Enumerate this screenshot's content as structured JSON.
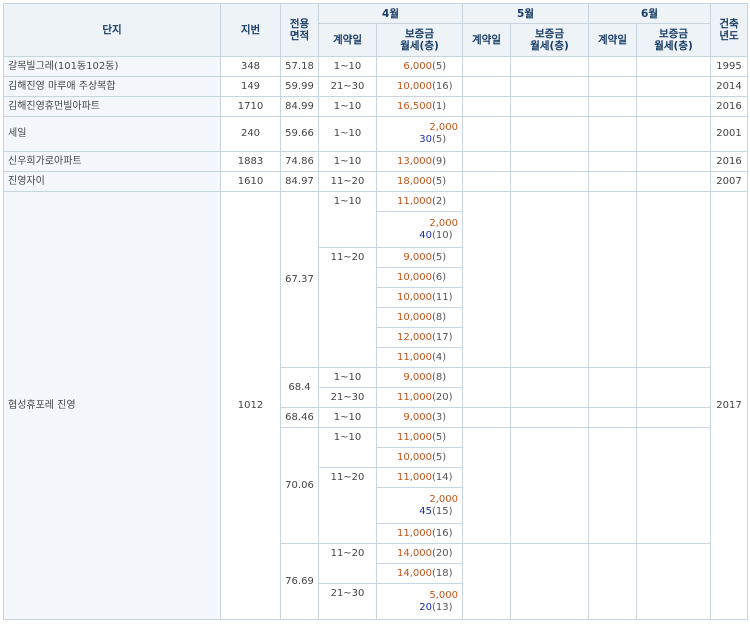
{
  "header": {
    "complex": "단지",
    "lot": "지번",
    "area": "전용\n면적",
    "months": [
      "4월",
      "5월",
      "6월"
    ],
    "contract_day": "계약일",
    "price": "보증금\n월세(층)",
    "built": "건축\n년도"
  },
  "rows": [
    {
      "name": "갈목빌그레(101동102동)",
      "lot": "348",
      "area": "57.18",
      "day": "1~10",
      "dep": "6,000",
      "floor": "(5)",
      "built": "1995"
    },
    {
      "name": "김해진영 마루애 주상복합",
      "lot": "149",
      "area": "59.99",
      "day": "21~30",
      "dep": "10,000",
      "floor": "(16)",
      "built": "2014"
    },
    {
      "name": "김해진영휴먼빌아파트",
      "lot": "1710",
      "area": "84.99",
      "day": "1~10",
      "dep": "16,500",
      "floor": "(1)",
      "built": "2016"
    },
    {
      "name": "세일",
      "lot": "240",
      "area": "59.66",
      "day": "1~10",
      "dep": "2,000",
      "rent": "30",
      "floor": "(5)",
      "built": "2001"
    },
    {
      "name": "신우희가로아파트",
      "lot": "1883",
      "area": "74.86",
      "day": "1~10",
      "dep": "13,000",
      "floor": "(9)",
      "built": "2016"
    },
    {
      "name": "진영자이",
      "lot": "1610",
      "area": "84.97",
      "day": "11~20",
      "dep": "18,000",
      "floor": "(5)",
      "built": "2007"
    }
  ],
  "big": {
    "name": "협성휴포레 진영",
    "lot": "1012",
    "built": "2017",
    "groups": [
      {
        "area": "67.37",
        "sub": [
          {
            "day": "1~10",
            "items": [
              {
                "dep": "11,000",
                "floor": "(2)"
              },
              {
                "dep": "2,000",
                "rent": "40",
                "floor": "(10)"
              }
            ]
          },
          {
            "day": "11~20",
            "items": [
              {
                "dep": "9,000",
                "floor": "(5)"
              },
              {
                "dep": "10,000",
                "floor": "(6)"
              },
              {
                "dep": "10,000",
                "floor": "(11)"
              },
              {
                "dep": "10,000",
                "floor": "(8)"
              },
              {
                "dep": "12,000",
                "floor": "(17)"
              },
              {
                "dep": "11,000",
                "floor": "(4)"
              }
            ]
          }
        ]
      },
      {
        "area": "68.4",
        "sub": [
          {
            "day": "1~10",
            "items": [
              {
                "dep": "9,000",
                "floor": "(8)"
              }
            ]
          },
          {
            "day": "21~30",
            "items": [
              {
                "dep": "11,000",
                "floor": "(20)"
              }
            ]
          }
        ]
      },
      {
        "area": "68.46",
        "sub": [
          {
            "day": "1~10",
            "items": [
              {
                "dep": "9,000",
                "floor": "(3)"
              }
            ]
          }
        ]
      },
      {
        "area": "70.06",
        "sub": [
          {
            "day": "1~10",
            "items": [
              {
                "dep": "11,000",
                "floor": "(5)"
              },
              {
                "dep": "10,000",
                "floor": "(5)"
              }
            ]
          },
          {
            "day": "11~20",
            "items": [
              {
                "dep": "11,000",
                "floor": "(14)"
              },
              {
                "dep": "2,000",
                "rent": "45",
                "floor": "(15)"
              },
              {
                "dep": "11,000",
                "floor": "(16)"
              }
            ]
          }
        ]
      },
      {
        "area": "76.69",
        "sub": [
          {
            "day": "11~20",
            "items": [
              {
                "dep": "14,000",
                "floor": "(20)"
              },
              {
                "dep": "14,000",
                "floor": "(18)"
              }
            ]
          },
          {
            "day": "21~30",
            "items": [
              {
                "dep": "5,000",
                "rent": "20",
                "floor": "(13)"
              }
            ]
          }
        ]
      }
    ]
  }
}
